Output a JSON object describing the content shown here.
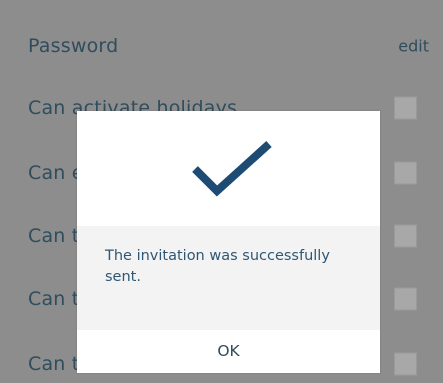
{
  "settings": {
    "rows": [
      {
        "label": "Password",
        "action": "edit",
        "has_checkbox": false
      },
      {
        "label": "Can activate holidays",
        "has_checkbox": true,
        "checked": false
      },
      {
        "label": "Can e",
        "has_checkbox": true,
        "checked": false
      },
      {
        "label": "Can t",
        "has_checkbox": true,
        "checked": false
      },
      {
        "label": "Can t",
        "has_checkbox": true,
        "checked": false
      },
      {
        "label": "Can t",
        "has_checkbox": true,
        "checked": false
      }
    ]
  },
  "dialog": {
    "icon": "checkmark-icon",
    "message": "The invitation was successfully sent.",
    "ok_label": "OK"
  },
  "colors": {
    "accent": "#1d4b73",
    "text": "#2f4d5c",
    "backdrop": "#8d8d8d"
  }
}
